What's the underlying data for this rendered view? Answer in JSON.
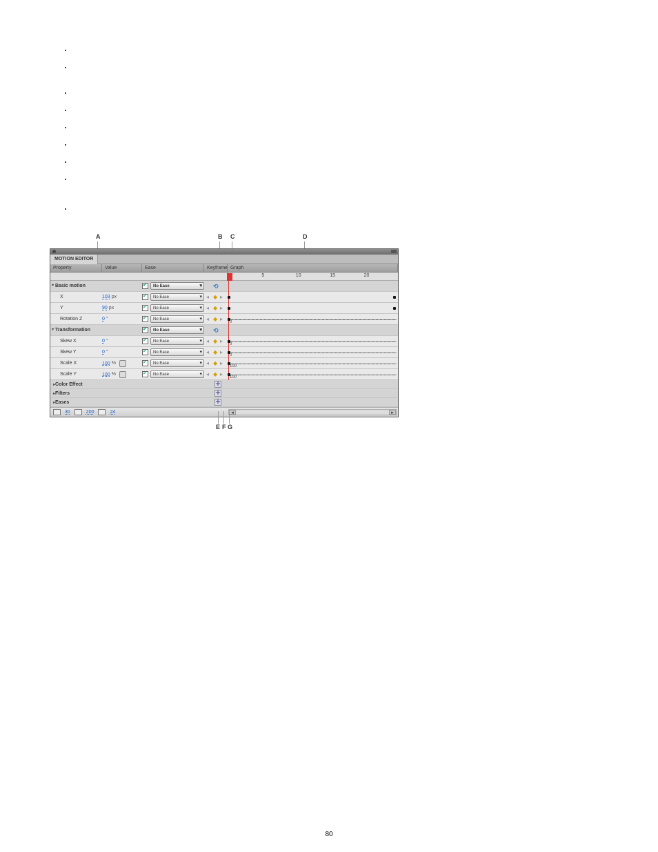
{
  "callouts": {
    "A": "A",
    "B": "B",
    "C": "C",
    "D": "D",
    "E": "E",
    "F": "F",
    "G": "G"
  },
  "panel": {
    "tab": "MOTION EDITOR",
    "headers": {
      "property": "Property",
      "value": "Value",
      "ease": "Ease",
      "keyframe": "Keyframe",
      "graph": "Graph"
    },
    "ruler": {
      "t5": "5",
      "t10": "10",
      "t15": "15",
      "t20": "20"
    }
  },
  "groups": {
    "basic_motion": "Basic motion",
    "transformation": "Transformation",
    "color_effect": "Color Effect",
    "filters": "Filters",
    "eases": "Eases"
  },
  "ease_label": "No Ease",
  "props": {
    "x": {
      "label": "X",
      "value": "103",
      "unit": "px"
    },
    "y": {
      "label": "Y",
      "value": "90",
      "unit": "px"
    },
    "rotz": {
      "label": "Rotation Z",
      "value": "0",
      "unit": "°"
    },
    "skewx": {
      "label": "Skew X",
      "value": "0",
      "unit": "°"
    },
    "skewy": {
      "label": "Skew Y",
      "value": "0",
      "unit": "°"
    },
    "scalex": {
      "label": "Scale X",
      "value": "100",
      "unit": "%"
    },
    "scaley": {
      "label": "Scale Y",
      "value": "100",
      "unit": "%"
    }
  },
  "footer": {
    "v1": "30",
    "v2": "200",
    "v3": "24"
  },
  "page_number": "80"
}
